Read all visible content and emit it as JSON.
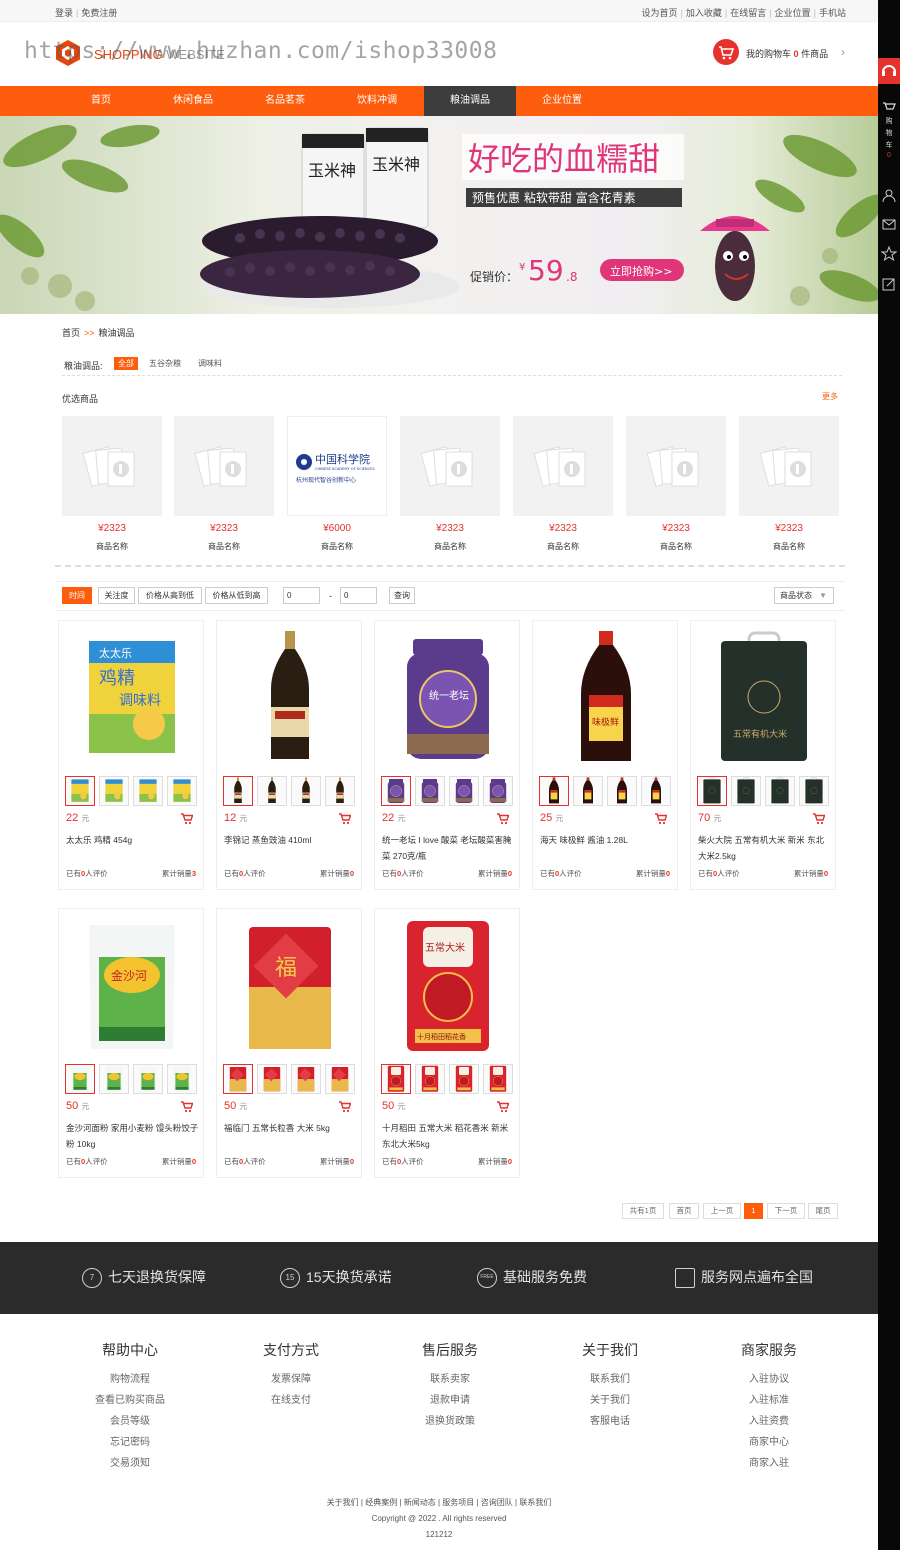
{
  "topbar": {
    "login": "登录",
    "register": "免费注册",
    "links": [
      "设为首页",
      "加入收藏",
      "在线留言",
      "企业位置",
      "手机站"
    ]
  },
  "header": {
    "logo_main": "SHOPPING",
    "logo_sub": "WEBSITE",
    "watermark": "https://www.huzhan.com/ishop33008",
    "cart_prefix": "我的购物车",
    "cart_count": "0",
    "cart_suffix": "件商品"
  },
  "nav": {
    "items": [
      "首页",
      "休闲食品",
      "名品茗茶",
      "饮料冲调",
      "粮油调品",
      "企业位置"
    ],
    "active_index": 4
  },
  "banner": {
    "headline": "好吃的血糯甜",
    "tags": "预售优惠  粘软带甜  富含花青素",
    "price_label": "促销价：",
    "price_currency": "¥",
    "price_int": "59",
    "price_dec": ".8",
    "cta": "立即抢购>>",
    "bag_label": "玉米神"
  },
  "breadcrumb": {
    "home": "首页",
    "sep": ">>",
    "current": "粮油调品"
  },
  "filter": {
    "label": "粮油调品:",
    "options": [
      "全部",
      "五谷杂粮",
      "调味料"
    ]
  },
  "picks": {
    "title": "优选商品",
    "more": "更多",
    "logo_text": "中国科学院",
    "logo_en": "CHINESE ACADEMY OF SCIENCES",
    "logo_sub": "杭州现代智谷创新中心",
    "items": [
      {
        "price": "¥2323",
        "name": "商品名称"
      },
      {
        "price": "¥2323",
        "name": "商品名称"
      },
      {
        "price": "¥6000",
        "name": "商品名称"
      },
      {
        "price": "¥2323",
        "name": "商品名称"
      },
      {
        "price": "¥2323",
        "name": "商品名称"
      },
      {
        "price": "¥2323",
        "name": "商品名称"
      },
      {
        "price": "¥2323",
        "name": "商品名称"
      }
    ]
  },
  "sort": {
    "buttons": [
      "时间",
      "关注度",
      "价格从高到低",
      "价格从低到高"
    ],
    "min": "0",
    "dash": "-",
    "max": "0",
    "query": "查询",
    "status": "商品状态"
  },
  "products": [
    {
      "price": "22",
      "unit": "元",
      "name": "太太乐 鸡精 454g",
      "reviews_prefix": "已有",
      "reviews": "0",
      "reviews_suffix": "人评价",
      "sold_label": "累计销量",
      "sold": "3"
    },
    {
      "price": "12",
      "unit": "元",
      "name": "李锦记 蒸鱼豉油 410ml",
      "reviews_prefix": "已有",
      "reviews": "0",
      "reviews_suffix": "人评价",
      "sold_label": "累计销量",
      "sold": "0"
    },
    {
      "price": "22",
      "unit": "元",
      "name": "统一老坛 I love 酸菜 老坛酸菜害腌菜 270克/瓶",
      "reviews_prefix": "已有",
      "reviews": "0",
      "reviews_suffix": "人评价",
      "sold_label": "累计销量",
      "sold": "0"
    },
    {
      "price": "25",
      "unit": "元",
      "name": "海天 味极鲜 酱油 1.28L",
      "reviews_prefix": "已有",
      "reviews": "0",
      "reviews_suffix": "人评价",
      "sold_label": "累计销量",
      "sold": "0"
    },
    {
      "price": "70",
      "unit": "元",
      "name": "柴火大院 五常有机大米 新米 东北大米2.5kg",
      "reviews_prefix": "已有",
      "reviews": "0",
      "reviews_suffix": "人评价",
      "sold_label": "累计销量",
      "sold": "0"
    },
    {
      "price": "50",
      "unit": "元",
      "name": "金沙河面粉 家用小麦粉 馒头粉饺子粉 10kg",
      "reviews_prefix": "已有",
      "reviews": "0",
      "reviews_suffix": "人评价",
      "sold_label": "累计销量",
      "sold": "0"
    },
    {
      "price": "50",
      "unit": "元",
      "name": "福临门 五常长粒香 大米 5kg",
      "reviews_prefix": "已有",
      "reviews": "0",
      "reviews_suffix": "人评价",
      "sold_label": "累计销量",
      "sold": "0"
    },
    {
      "price": "50",
      "unit": "元",
      "name": "十月稻田 五常大米 稻花香米 新米 东北大米5kg",
      "reviews_prefix": "已有",
      "reviews": "0",
      "reviews_suffix": "人评价",
      "sold_label": "累计销量",
      "sold": "0"
    }
  ],
  "product_labels": {
    "p0_brand": "太太乐",
    "p0_line1": "鸡精",
    "p0_line2": "调味料",
    "p2_label": "统一老坛",
    "p3_label": "味极鲜",
    "p4_label": "五常有机大米",
    "p5_label": "金沙河",
    "p6_label": "福",
    "p7_label": "五常大米",
    "p7_sub": "十月稻田稻花香"
  },
  "pager": {
    "total": "共有1页",
    "first": "首页",
    "prev": "上一页",
    "current": "1",
    "next": "下一页",
    "last": "尾页"
  },
  "services": [
    {
      "icon": "7",
      "text": "七天退换货保障"
    },
    {
      "icon": "15",
      "text": "15天换货承诺"
    },
    {
      "icon": "FREE",
      "text": "基础服务免费"
    },
    {
      "icon": "map",
      "text": "服务网点遍布全国"
    }
  ],
  "footer_cols": [
    {
      "title": "帮助中心",
      "items": [
        "购物流程",
        "查看已购买商品",
        "会员等级",
        "忘记密码",
        "交易须知"
      ]
    },
    {
      "title": "支付方式",
      "items": [
        "发票保障",
        "在线支付"
      ]
    },
    {
      "title": "售后服务",
      "items": [
        "联系卖家",
        "退款申请",
        "退换货政策"
      ]
    },
    {
      "title": "关于我们",
      "items": [
        "联系我们",
        "关于我们",
        "客服电话"
      ]
    },
    {
      "title": "商家服务",
      "items": [
        "入驻协议",
        "入驻标准",
        "入驻资费",
        "商家中心",
        "商家入驻"
      ]
    }
  ],
  "footer_links": [
    "关于我们",
    "经典案例",
    "新闻动态",
    "服务项目",
    "咨询团队",
    "联系我们"
  ],
  "copyright": "Copyright @ 2022 . All rights reserved",
  "icp": "121212",
  "sidebar": {
    "cart_label": "购物车",
    "cart_count": "0"
  },
  "colors": {
    "accent": "#fd5d0d",
    "price": "#e5322d",
    "nav_active": "#3d3d3d",
    "footer_bar": "#2b2b2b"
  }
}
